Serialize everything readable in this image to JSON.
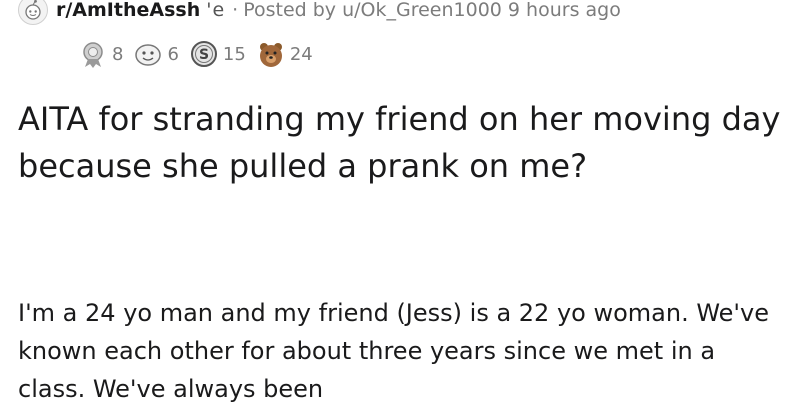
{
  "post": {
    "subreddit": "r/AmItheAssh",
    "subreddit_truncated_fragment": "'e",
    "separator": "·",
    "posted_by": "Posted by u/Ok_Green1000 9 hours ago",
    "subreddit_icon": "snoo-icon",
    "awards": [
      {
        "icon": "silver-award-icon",
        "count": "8"
      },
      {
        "icon": "helpful-award-icon",
        "count": "6"
      },
      {
        "icon": "s-coin-award-icon",
        "count": "15"
      },
      {
        "icon": "bear-award-icon",
        "count": "24"
      }
    ],
    "title": "AITA for stranding my friend on her moving day because she pulled a prank on me?",
    "body": "I'm a 24 yo man and my friend (Jess) is a 22 yo woman. We've known each other for about three years since we met in a class. We've always been"
  },
  "colors": {
    "text": "#1a1a1b",
    "meta": "#7c7c7c",
    "background": "#ffffff"
  }
}
